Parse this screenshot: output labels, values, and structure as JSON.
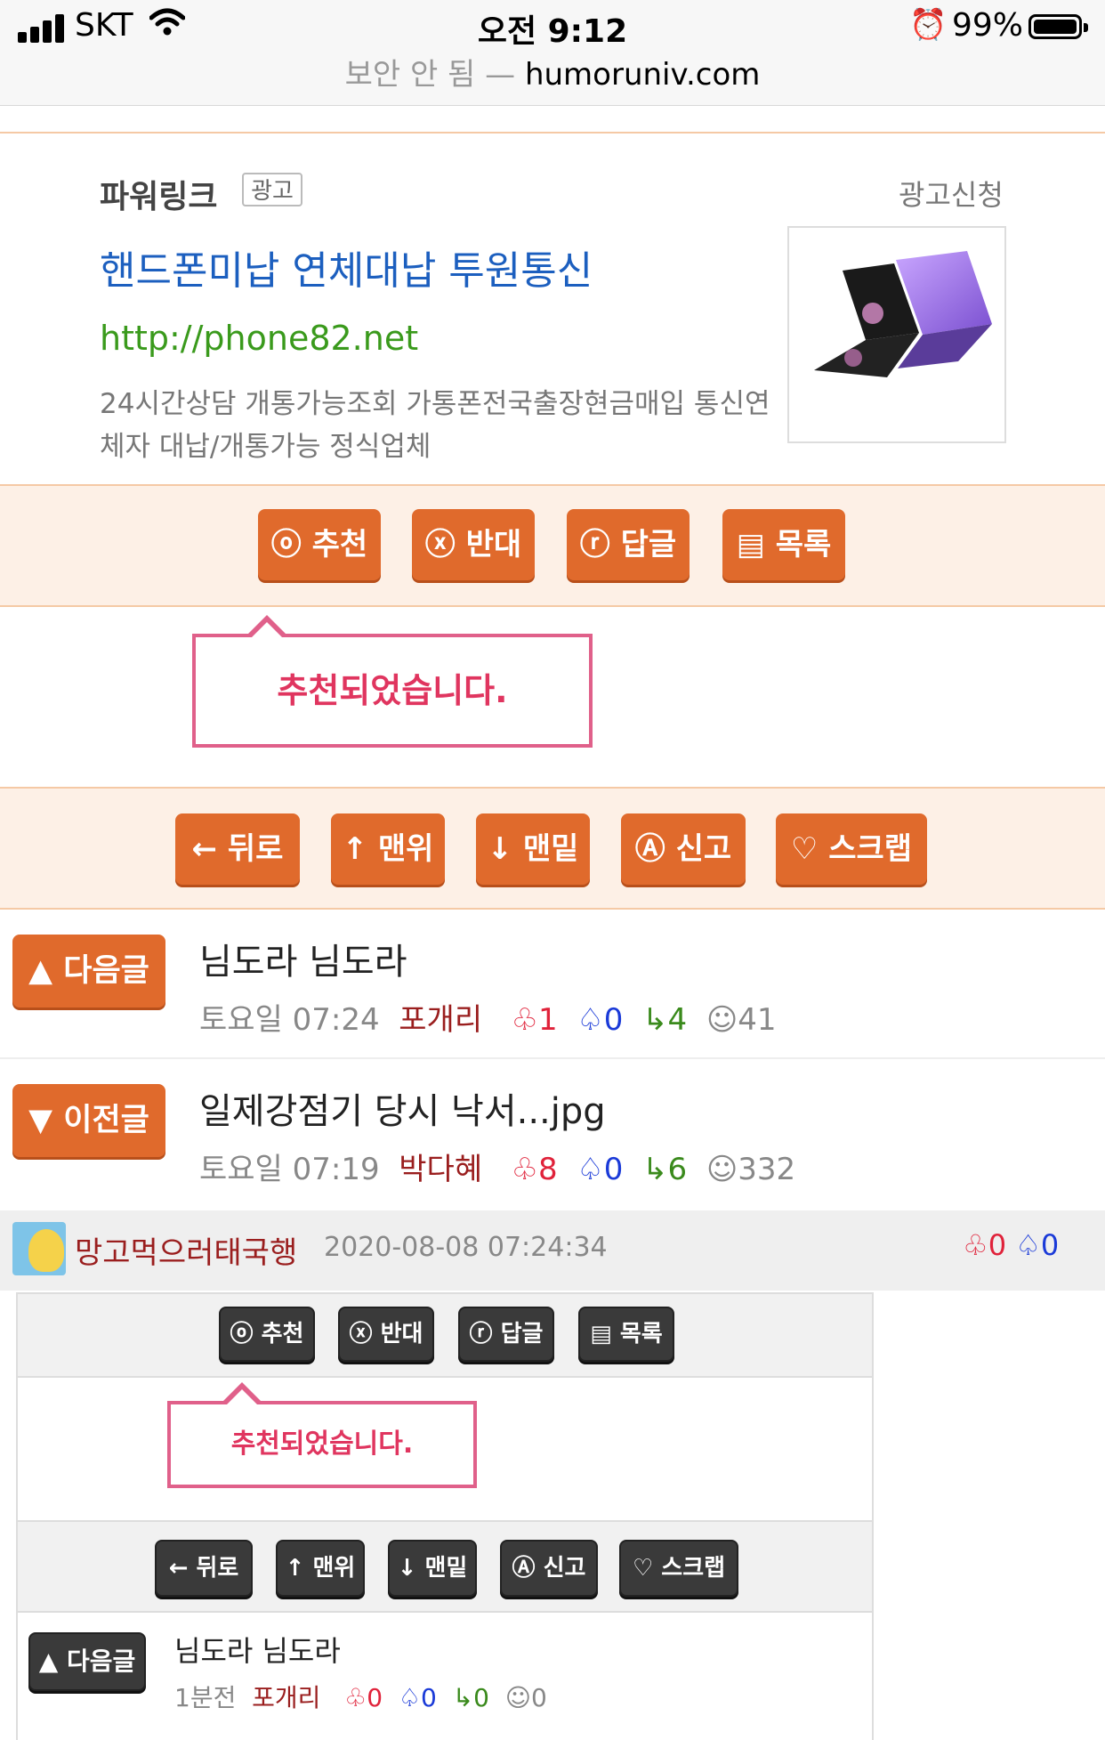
{
  "status_bar": {
    "carrier": "SKT",
    "time": "오전 9:12",
    "battery": "99%",
    "url_insecure": "보안 안 됨 —",
    "url_domain": "humoruniv.com"
  },
  "ad": {
    "title": "파워링크",
    "badge": "광고",
    "apply": "광고신청",
    "headline": "핸드폰미납 연체대납 투원통신",
    "url": "http://phone82.net",
    "description": "24시간상담 개통가능조회 가통폰전국출장현금매입 통신연체자 대납/개통가능 정식업체"
  },
  "vote_buttons": {
    "recommend": "ⓞ 추천",
    "oppose": "ⓧ 반대",
    "reply": "ⓡ 답글",
    "list": "▤ 목록"
  },
  "recommend_message": "추천되었습니다.",
  "nav_buttons": {
    "back": "← 뒤로",
    "top": "↑ 맨위",
    "bottom": "↓ 맨밑",
    "report": "Ⓐ 신고",
    "scrap": "♡ 스크랩"
  },
  "next_post": {
    "button": "▲ 다음글",
    "title": "님도라 님도라",
    "time": "토요일 07:24",
    "author": "포개리",
    "up": "1",
    "down": "0",
    "replies": "4",
    "views": "41"
  },
  "prev_post": {
    "button": "▼ 이전글",
    "title": "일제강점기 당시 낙서...jpg",
    "time": "토요일 07:19",
    "author": "박다혜",
    "up": "8",
    "down": "0",
    "replies": "6",
    "views": "332"
  },
  "comment": {
    "author": "망고먹으러태국행",
    "date": "2020-08-08 07:24:34",
    "up": "0",
    "down": "0"
  },
  "inner_vote_buttons": {
    "recommend": "ⓞ 추천",
    "oppose": "ⓧ 반대",
    "reply": "ⓡ 답글",
    "list": "▤ 목록"
  },
  "inner_recommend_message": "추천되었습니다.",
  "inner_nav_buttons": {
    "back": "← 뒤로",
    "top": "↑ 맨위",
    "bottom": "↓ 맨밑",
    "report": "Ⓐ 신고",
    "scrap": "♡ 스크랩"
  },
  "inner_next_post": {
    "button": "▲ 다음글",
    "title": "님도라 님도라",
    "time": "1분전",
    "author": "포개리",
    "up": "0",
    "down": "0",
    "replies": "0",
    "views": "0"
  },
  "icons": {
    "up": "thumbs-up-icon",
    "down": "thumbs-down-icon",
    "reply": "reply-arrow-icon",
    "view": "smiley-icon"
  },
  "colors": {
    "accent": "#e06a2c",
    "band": "#fdf0e6",
    "alert": "#e0355f",
    "link": "#1c5fbf",
    "url": "#3a9a1c"
  }
}
